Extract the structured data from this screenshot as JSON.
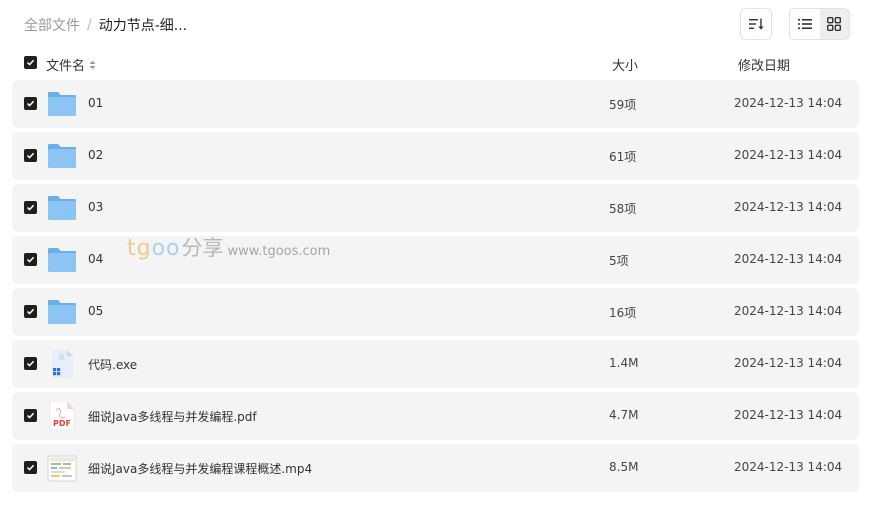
{
  "breadcrumb": {
    "root": "全部文件",
    "separator": "/",
    "current": "动力节点-细..."
  },
  "toolbar": {
    "sort_icon": "sort-lines-icon",
    "list_view_icon": "list-view-icon",
    "grid_view_icon": "grid-view-icon"
  },
  "header": {
    "name": "文件名",
    "size": "大小",
    "date": "修改日期"
  },
  "files": [
    {
      "name": "01",
      "size": "59项",
      "date": "2024-12-13 14:04",
      "type": "folder"
    },
    {
      "name": "02",
      "size": "61项",
      "date": "2024-12-13 14:04",
      "type": "folder"
    },
    {
      "name": "03",
      "size": "58项",
      "date": "2024-12-13 14:04",
      "type": "folder"
    },
    {
      "name": "04",
      "size": "5项",
      "date": "2024-12-13 14:04",
      "type": "folder"
    },
    {
      "name": "05",
      "size": "16项",
      "date": "2024-12-13 14:04",
      "type": "folder"
    },
    {
      "name": "代码.exe",
      "size": "1.4M",
      "date": "2024-12-13 14:04",
      "type": "exe"
    },
    {
      "name": "细说Java多线程与并发编程.pdf",
      "size": "4.7M",
      "date": "2024-12-13 14:04",
      "type": "pdf",
      "badge": "PDF"
    },
    {
      "name": "细说Java多线程与并发编程课程概述.mp4",
      "size": "8.5M",
      "date": "2024-12-13 14:04",
      "type": "video"
    }
  ],
  "watermark": {
    "brand_prefix": "tg",
    "brand_oo": "oo",
    "brand_cn": "分享",
    "url": "www.tgoos.com"
  },
  "colors": {
    "folder": "#7db9f0",
    "checkbox": "#1f1f1f",
    "row_bg": "#f4f4f4",
    "pdf_red": "#e5413a"
  }
}
